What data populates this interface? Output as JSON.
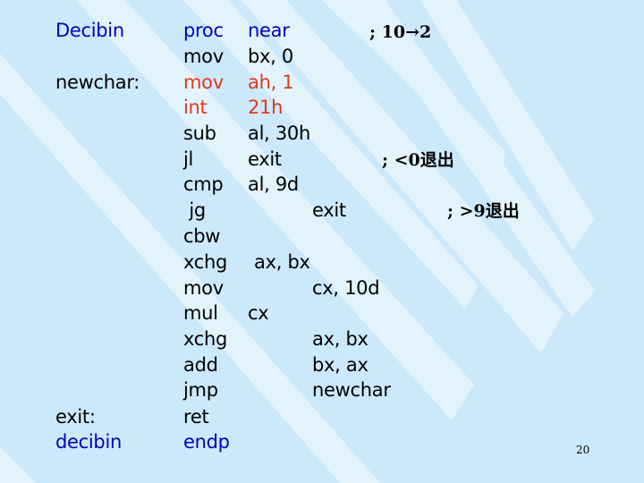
{
  "labels": {
    "decibin_start": "Decibin",
    "newchar": "newchar:",
    "exit": "exit:",
    "decibin_end": "decibin"
  },
  "code": [
    {
      "op": "proc",
      "args": "near",
      "style": "blue"
    },
    {
      "op": "mov",
      "args": "bx, 0",
      "style": "normal"
    },
    {
      "op": "mov",
      "args": "ah, 1",
      "style": "red"
    },
    {
      "op": "int",
      "args": "21h",
      "style": "red"
    },
    {
      "op": "sub",
      "args": "al, 30h",
      "style": "normal"
    },
    {
      "op": "jl",
      "args": "exit",
      "style": "normal"
    },
    {
      "op": "cmp",
      "args": "al, 9d",
      "style": "normal"
    },
    {
      "op": " jg",
      "args": "exit",
      "style": "normal"
    },
    {
      "op": "cbw",
      "args": "",
      "style": "normal"
    },
    {
      "op": "xchg",
      "args": "ax, bx",
      "style": "normal"
    },
    {
      "op": "mov",
      "args": "cx, 10d",
      "style": "normal"
    },
    {
      "op": "mul",
      "args": "cx",
      "style": "normal"
    },
    {
      "op": "xchg",
      "args": "ax, bx",
      "style": "normal"
    },
    {
      "op": "add",
      "args": "bx, ax",
      "style": "normal"
    },
    {
      "op": "jmp",
      "args": "newchar",
      "style": "normal"
    },
    {
      "op": "ret",
      "args": "",
      "style": "normal"
    },
    {
      "op": "endp",
      "args": "",
      "style": "blue"
    }
  ],
  "comments": {
    "proc": "; 10→2",
    "jl": "; <0退出",
    "jg": "; >9退出"
  },
  "page_number": "20",
  "colors": {
    "background": "#cce9fb",
    "stripe": "#e3f3fc",
    "keyword_blue": "#0000c0",
    "highlight_red": "#e03a1c"
  }
}
